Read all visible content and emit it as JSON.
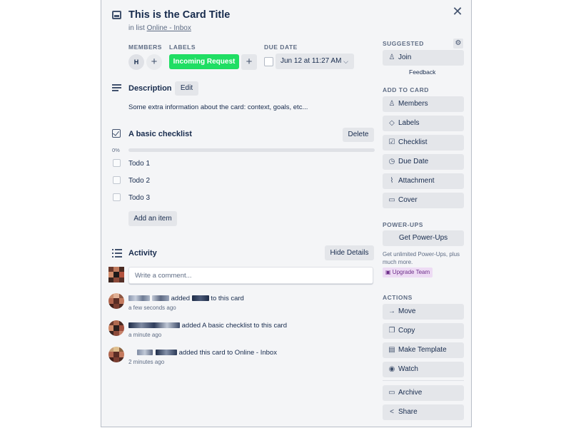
{
  "card": {
    "title": "This is the Card Title",
    "in_list_prefix": "in list",
    "list_name": "Online - Inbox"
  },
  "members": {
    "label": "MEMBERS",
    "initial": "H",
    "add": "+"
  },
  "labels": {
    "label": "LABELS",
    "chip": "Incoming Request",
    "chip_color": "#1fde63",
    "add": "+"
  },
  "due": {
    "label": "DUE DATE",
    "value": "Jun 12 at 11:27 AM",
    "chevron": "⌵"
  },
  "description": {
    "title": "Description",
    "edit": "Edit",
    "text": "Some extra information about the card: context, goals, etc..."
  },
  "checklist": {
    "title": "A basic checklist",
    "delete": "Delete",
    "progress_text": "0%",
    "progress": 0,
    "items": [
      "Todo 1",
      "Todo 2",
      "Todo 3"
    ],
    "add_item": "Add an item"
  },
  "activity": {
    "title": "Activity",
    "hide_details": "Hide Details",
    "comment_placeholder": "Write a comment...",
    "entries": [
      {
        "text_a": "added",
        "text_b": "to this card",
        "time": "a few seconds ago"
      },
      {
        "text_a": "added A basic checklist to this card",
        "time": "a minute ago"
      },
      {
        "text_a": "added this card to Online - Inbox",
        "time": "2 minutes ago"
      }
    ]
  },
  "sidebar": {
    "suggested": "SUGGESTED",
    "join": "Join",
    "feedback": "Feedback",
    "add_to_card": "ADD TO CARD",
    "add_items": [
      {
        "label": "Members",
        "icon": "person-icon"
      },
      {
        "label": "Labels",
        "icon": "tag-icon"
      },
      {
        "label": "Checklist",
        "icon": "checkbox-icon"
      },
      {
        "label": "Due Date",
        "icon": "clock-icon"
      },
      {
        "label": "Attachment",
        "icon": "paperclip-icon"
      },
      {
        "label": "Cover",
        "icon": "cover-icon"
      }
    ],
    "power_ups": "POWER-UPS",
    "get_power_ups": "Get Power-Ups",
    "power_ups_note": "Get unlimited Power-Ups, plus much more.",
    "upgrade_team": "Upgrade Team",
    "actions": "ACTIONS",
    "action_items": [
      {
        "label": "Move",
        "icon": "arrow-right-icon"
      },
      {
        "label": "Copy",
        "icon": "copy-icon"
      },
      {
        "label": "Make Template",
        "icon": "template-icon"
      },
      {
        "label": "Watch",
        "icon": "eye-icon"
      }
    ],
    "archive": "Archive",
    "share": "Share"
  },
  "colors": {
    "modal_bg": "#f4f5f7",
    "button_bg": "#e4e6ea",
    "text": "#172b4d",
    "muted": "#5e6c84",
    "accent_purple": "#6e2f8a"
  }
}
